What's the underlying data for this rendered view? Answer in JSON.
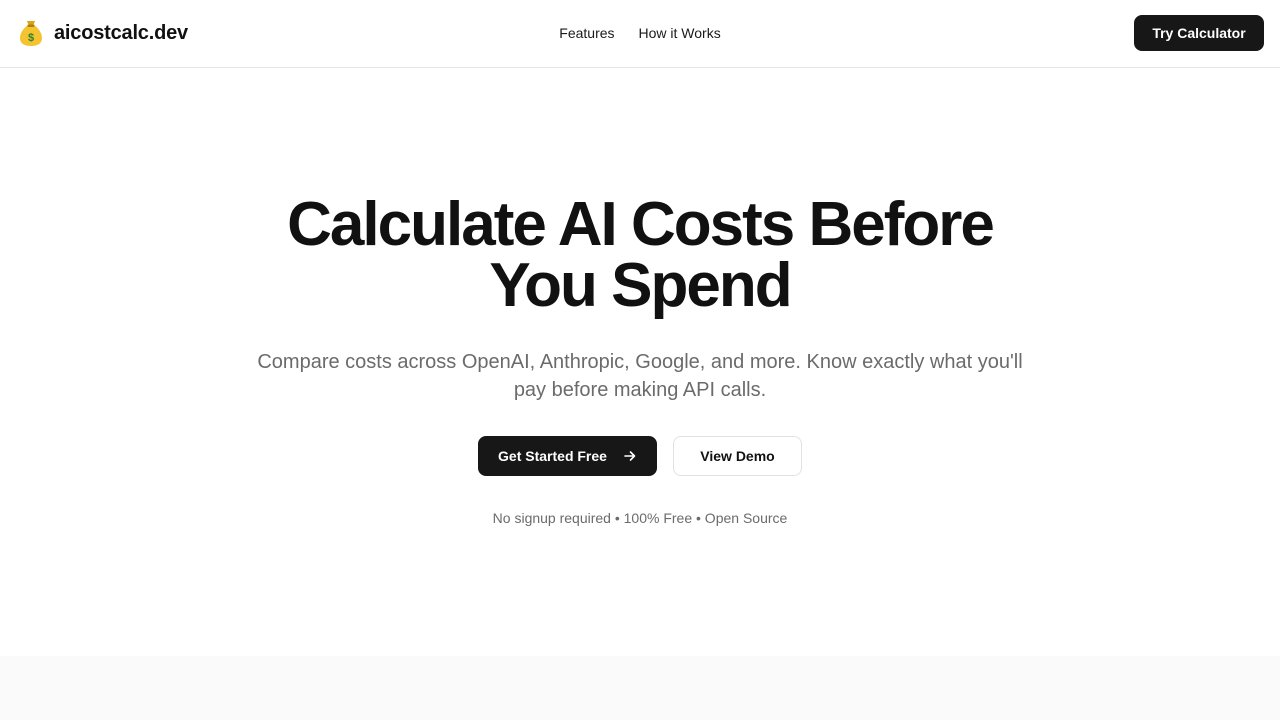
{
  "brand": {
    "icon": "money-bag-icon",
    "name": "aicostcalc.dev"
  },
  "nav": {
    "links": [
      {
        "label": "Features"
      },
      {
        "label": "How it Works"
      }
    ],
    "cta_label": "Try Calculator"
  },
  "hero": {
    "title": "Calculate AI Costs Before You Spend",
    "subtitle": "Compare costs across OpenAI, Anthropic, Google, and more. Know exactly what you'll pay before making API calls.",
    "primary_label": "Get Started Free",
    "primary_icon": "arrow-right-icon",
    "secondary_label": "View Demo",
    "note": "No signup required • 100% Free • Open Source"
  },
  "colors": {
    "primary": "#171717",
    "text_muted": "#6b6b6b",
    "border": "#e5e5e5",
    "section_bg": "#fafafa"
  }
}
